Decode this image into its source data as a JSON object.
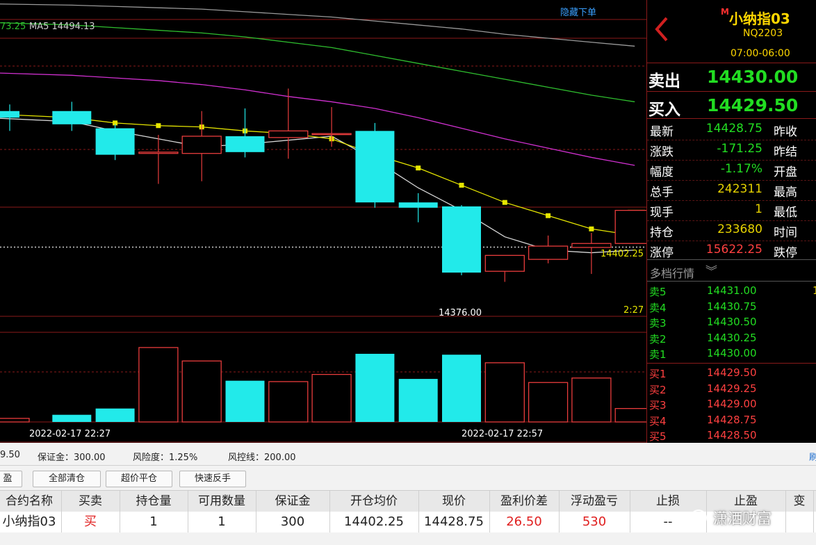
{
  "chart": {
    "ma_label_1": "73.25",
    "ma_label_2": "MA5 14494.13",
    "hide_button": "隐藏下单",
    "price_marker": "14402.25",
    "low_marker": "14376.00",
    "time_marker": "2:27",
    "x_label_1": "2022-02-17 22:27",
    "x_label_2": "2022-02-17 22:57"
  },
  "chart_data": {
    "type": "candlestick",
    "ylim": [
      14350,
      14560
    ],
    "candles": [
      {
        "o": 14505,
        "h": 14510,
        "l": 14490,
        "c": 14500
      },
      {
        "o": 14505,
        "h": 14512,
        "l": 14490,
        "c": 14495
      },
      {
        "o": 14492,
        "h": 14495,
        "l": 14468,
        "c": 14472
      },
      {
        "o": 14473,
        "h": 14487,
        "l": 14450,
        "c": 14474
      },
      {
        "o": 14473,
        "h": 14505,
        "l": 14452,
        "c": 14486
      },
      {
        "o": 14486,
        "h": 14507,
        "l": 14470,
        "c": 14474
      },
      {
        "o": 14485,
        "h": 14522,
        "l": 14469,
        "c": 14490
      },
      {
        "o": 14488,
        "h": 14508,
        "l": 14478,
        "c": 14488
      },
      {
        "o": 14490,
        "h": 14496,
        "l": 14432,
        "c": 14436
      },
      {
        "o": 14436,
        "h": 14443,
        "l": 14421,
        "c": 14432
      },
      {
        "o": 14433,
        "h": 14434,
        "l": 14381,
        "c": 14383
      },
      {
        "o": 14384,
        "h": 14396,
        "l": 14376,
        "c": 14396
      },
      {
        "o": 14393,
        "h": 14411,
        "l": 14390,
        "c": 14403
      },
      {
        "o": 14402,
        "h": 14413,
        "l": 14382,
        "c": 14405
      },
      {
        "o": 14405,
        "h": 14405,
        "l": 14405,
        "c": 14430
      }
    ],
    "volumes": [
      {
        "v": 4,
        "up": true
      },
      {
        "v": 8,
        "up": false
      },
      {
        "v": 15,
        "up": false
      },
      {
        "v": 83,
        "up": true
      },
      {
        "v": 68,
        "up": true
      },
      {
        "v": 46,
        "up": false
      },
      {
        "v": 45,
        "up": true
      },
      {
        "v": 53,
        "up": true
      },
      {
        "v": 76,
        "up": false
      },
      {
        "v": 48,
        "up": false
      },
      {
        "v": 75,
        "up": false
      },
      {
        "v": 66,
        "up": true
      },
      {
        "v": 44,
        "up": true
      },
      {
        "v": 49,
        "up": true
      },
      {
        "v": 15,
        "up": true
      }
    ],
    "ma5": [
      14503,
      14500,
      14496,
      14494,
      14493,
      14490,
      14488,
      14484,
      14472,
      14462,
      14449,
      14436,
      14426,
      14416,
      14411
    ],
    "ma10": [
      14500,
      14497,
      14490,
      14484,
      14478,
      14480,
      14483,
      14486,
      14468,
      14447,
      14430,
      14410,
      14400,
      14398,
      14400
    ],
    "ma20": [
      14534,
      14532,
      14530,
      14528,
      14525,
      14521,
      14516,
      14512,
      14507,
      14500,
      14492,
      14484,
      14477,
      14470,
      14464
    ],
    "ma60": [
      14572,
      14570,
      14568,
      14566,
      14564,
      14561,
      14557,
      14553,
      14547,
      14541,
      14535,
      14529,
      14523,
      14517,
      14512
    ],
    "ma_long": [
      14586,
      14585,
      14584,
      14583,
      14582,
      14580,
      14578,
      14576,
      14573,
      14570,
      14567,
      14563,
      14560,
      14557,
      14554
    ]
  },
  "quote": {
    "logo": "M",
    "name": "小纳指03",
    "code": "NQ2203",
    "session": "07:00-06:00",
    "back_icon": "chevron-left-icon",
    "sell_label": "卖出",
    "sell_price": "14430.00",
    "buy_label": "买入",
    "buy_price": "14429.50",
    "rows": [
      {
        "label": "最新",
        "value": "14428.75",
        "color": "#22dd22",
        "label2": "昨收"
      },
      {
        "label": "涨跌",
        "value": "-171.25",
        "color": "#22dd22",
        "label2": "昨结"
      },
      {
        "label": "幅度",
        "value": "-1.17%",
        "color": "#22dd22",
        "label2": "开盘"
      },
      {
        "label": "总手",
        "value": "242311",
        "color": "#e6d200",
        "label2": "最高"
      },
      {
        "label": "现手",
        "value": "1",
        "color": "#e6d200",
        "label2": "最低"
      },
      {
        "label": "持仓",
        "value": "233680",
        "color": "#e6d200",
        "label2": "时间"
      },
      {
        "label": "涨停",
        "value": "15622.25",
        "color": "#ff4040",
        "label2": "跌停"
      }
    ],
    "depth_title": "多档行情",
    "depth_icon": "double-chevron-down-icon",
    "asks": [
      {
        "label": "卖5",
        "price": "14431.00",
        "vol": "1"
      },
      {
        "label": "卖4",
        "price": "14430.75",
        "vol": ""
      },
      {
        "label": "卖3",
        "price": "14430.50",
        "vol": ""
      },
      {
        "label": "卖2",
        "price": "14430.25",
        "vol": ""
      },
      {
        "label": "卖1",
        "price": "14430.00",
        "vol": ""
      }
    ],
    "bids": [
      {
        "label": "买1",
        "price": "14429.50"
      },
      {
        "label": "买2",
        "price": "14429.25"
      },
      {
        "label": "买3",
        "price": "14429.00"
      },
      {
        "label": "买4",
        "price": "14428.75"
      },
      {
        "label": "买5",
        "price": "14428.50"
      }
    ]
  },
  "account": {
    "balance_partial": "9.50",
    "margin": "保证金：300.00",
    "risk": "风险度：1.25%",
    "risk_line": "风控线：200.00",
    "right_link": "刷"
  },
  "buttons": {
    "partial": "盈",
    "close_all": "全部清仓",
    "over_price_close": "超价平仓",
    "fast_reverse": "快速反手"
  },
  "table": {
    "headers": [
      "合约名称",
      "买卖",
      "持仓量",
      "可用数量",
      "保证金",
      "开仓均价",
      "现价",
      "盈利价差",
      "浮动盈亏",
      "止损",
      "止盈",
      "变"
    ],
    "row": {
      "name": "小纳指03",
      "side": "买",
      "position": "1",
      "available": "1",
      "margin": "300",
      "open_avg": "14402.25",
      "current": "14428.75",
      "profit_spread": "26.50",
      "float_pnl": "530",
      "stop_loss": "--",
      "take_profit": ""
    }
  },
  "watermark": "潇洒财富",
  "colors": {
    "up": "#e83c3c",
    "down": "#22eaea",
    "ma5": "#e6e600",
    "ma10": "#d8d8d8",
    "ma20": "#d030d0",
    "ma60": "#2fbf2f",
    "ma_long": "#9a9a9a",
    "grid": "#8b1a1a"
  }
}
